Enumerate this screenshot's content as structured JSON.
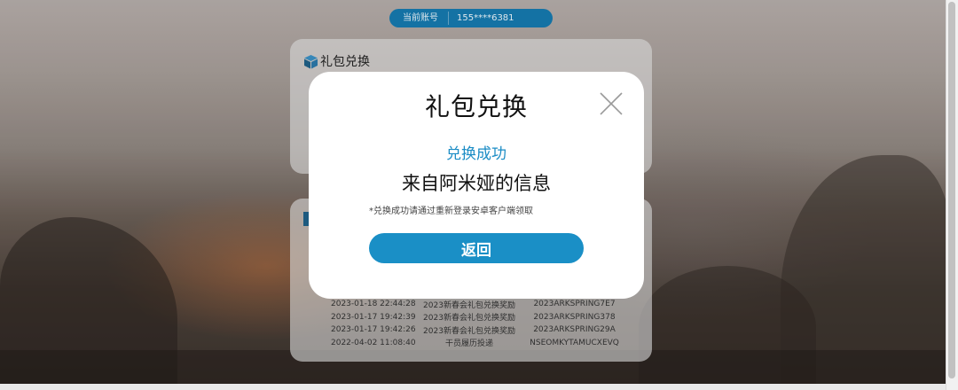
{
  "account": {
    "label": "当前账号",
    "value": "155****6381"
  },
  "redeem_card": {
    "title": "礼包兑换"
  },
  "history": {
    "rows": [
      {
        "time": "2023-01-18 22:44:28",
        "name": "2023新春会礼包兑换奖励",
        "code": "2023ARKSPRING7E7"
      },
      {
        "time": "2023-01-17 19:42:39",
        "name": "2023新春会礼包兑换奖励",
        "code": "2023ARKSPRING378"
      },
      {
        "time": "2023-01-17 19:42:26",
        "name": "2023新春会礼包兑换奖励",
        "code": "2023ARKSPRING29A"
      },
      {
        "time": "2022-04-02 11:08:40",
        "name": "干员履历投递",
        "code": "NSEOMKYTAMUCXEVQ"
      }
    ]
  },
  "modal": {
    "title": "礼包兑换",
    "success": "兑换成功",
    "message": "来自阿米娅的信息",
    "note": "*兑换成功请通过重新登录安卓客户端领取",
    "return_label": "返回"
  },
  "icons": {
    "close": "close-icon",
    "box": "box-icon"
  },
  "colors": {
    "accent": "#1a8fc6",
    "account_pill": "#1679ad"
  }
}
